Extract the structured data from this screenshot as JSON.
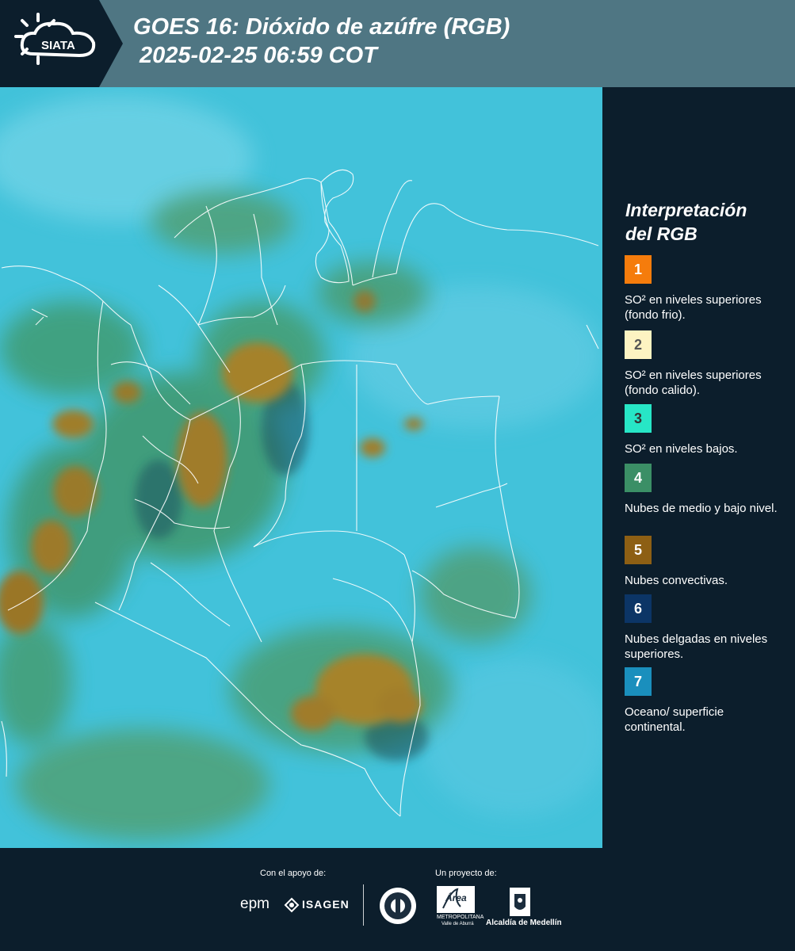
{
  "header": {
    "logo_text": "SIATA",
    "title_line1": "GOES 16: Dióxido de azúfre (RGB)",
    "title_line2": "2025-02-25 06:59 COT"
  },
  "legend": {
    "title_line1": "Interpretación",
    "title_line2": "del RGB",
    "items": [
      {
        "num": "1",
        "color": "#f57c0c",
        "num_color": "#ffffff",
        "text": "SO² en niveles superiores (fondo frio)."
      },
      {
        "num": "2",
        "color": "#fdf3c2",
        "num_color": "#555555",
        "text": "SO² en niveles superiores (fondo calido)."
      },
      {
        "num": "3",
        "color": "#27e6c6",
        "num_color": "#333333",
        "text": "SO² en niveles bajos."
      },
      {
        "num": "4",
        "color": "#3b8f66",
        "num_color": "#ffffff",
        "text": "Nubes de medio y bajo nivel."
      },
      {
        "num": "5",
        "color": "#8d5f14",
        "num_color": "#ffffff",
        "text": "Nubes convectivas."
      },
      {
        "num": "6",
        "color": "#0c3566",
        "num_color": "#ffffff",
        "text": "Nubes delgadas en niveles superiores."
      },
      {
        "num": "7",
        "color": "#1a8fbd",
        "num_color": "#ffffff",
        "text": "Oceano/ superficie continental."
      }
    ]
  },
  "footer": {
    "support_label": "Con el apoyo de:",
    "project_label": "Un proyecto de:",
    "epm": "epm",
    "isagen": "ISAGEN",
    "area_line1": "Área",
    "area_line2": "METROPOLITANA",
    "area_line3": "Valle de Aburrá",
    "alcaldia": "Alcaldía de Medellín"
  }
}
